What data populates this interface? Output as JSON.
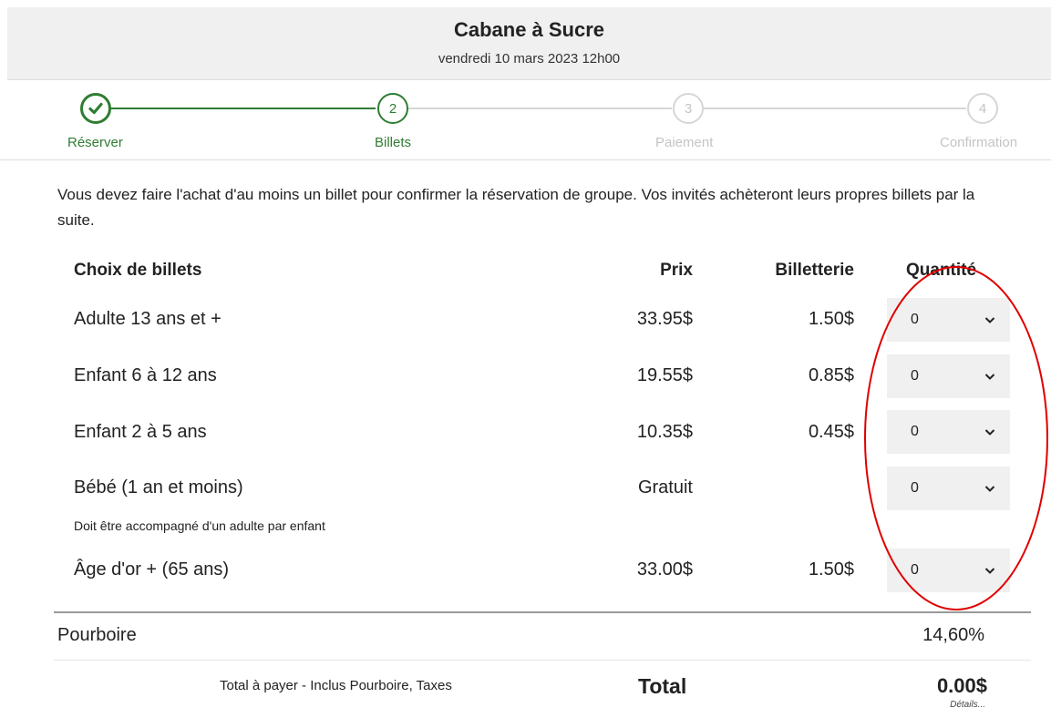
{
  "header": {
    "title": "Cabane à Sucre",
    "date": "vendredi 10 mars 2023 12h00"
  },
  "steps": [
    {
      "label": "Réserver",
      "number": "",
      "state": "done",
      "icon": "checkmark-icon"
    },
    {
      "label": "Billets",
      "number": "2",
      "state": "active"
    },
    {
      "label": "Paiement",
      "number": "3",
      "state": "todo"
    },
    {
      "label": "Confirmation",
      "number": "4",
      "state": "todo"
    }
  ],
  "intro": "Vous devez faire l'achat d'au moins un billet pour confirmer la réservation de groupe. Vos invités achèteront leurs propres billets par la suite.",
  "table": {
    "headers": {
      "choice": "Choix de billets",
      "price": "Prix",
      "fee": "Billetterie",
      "qty": "Quantité"
    },
    "rows": [
      {
        "name": "Adulte 13 ans et +",
        "price": "33.95$",
        "fee": "1.50$",
        "qty": "0"
      },
      {
        "name": "Enfant 6 à 12 ans",
        "price": "19.55$",
        "fee": "0.85$",
        "qty": "0"
      },
      {
        "name": "Enfant 2 à 5 ans",
        "price": "10.35$",
        "fee": "0.45$",
        "qty": "0"
      },
      {
        "name": "Bébé (1 an et moins)",
        "price": "Gratuit",
        "fee": "",
        "qty": "0"
      },
      {
        "name": "Âge d'or + (65 ans)",
        "price": "33.00$",
        "fee": "1.50$",
        "qty": "0"
      }
    ],
    "note": "Doit être accompagné d'un adulte par enfant"
  },
  "tip": {
    "label": "Pourboire",
    "value": "14,60%"
  },
  "total": {
    "description": "Total à payer - Inclus Pourboire, Taxes",
    "label": "Total",
    "amount": "0.00$",
    "details": "Détails..."
  },
  "colors": {
    "accent": "#2f7d32",
    "inactive": "#d6d6d6",
    "annotation": "#e00000",
    "header_bg": "#f0f0f0"
  }
}
